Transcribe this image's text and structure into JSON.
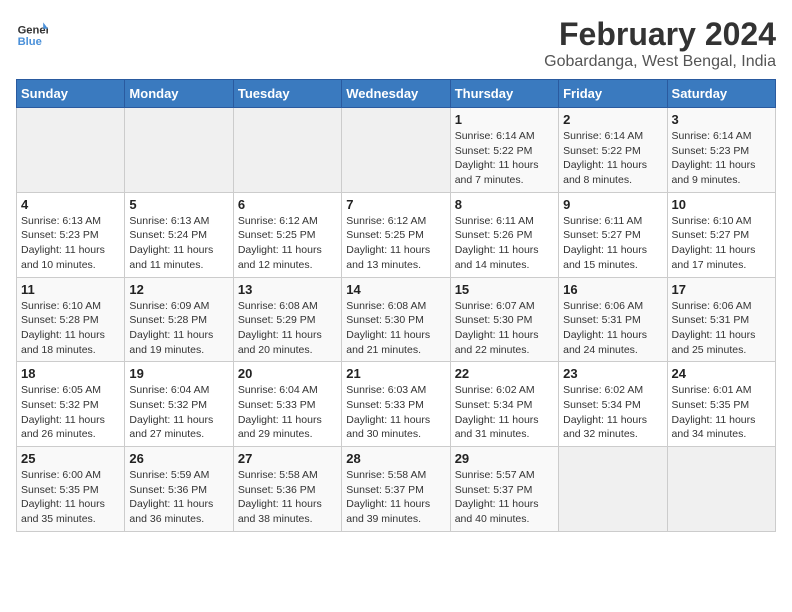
{
  "header": {
    "logo_line1": "General",
    "logo_line2": "Blue",
    "month_year": "February 2024",
    "location": "Gobardanga, West Bengal, India"
  },
  "days_of_week": [
    "Sunday",
    "Monday",
    "Tuesday",
    "Wednesday",
    "Thursday",
    "Friday",
    "Saturday"
  ],
  "weeks": [
    [
      {
        "day": "",
        "info": ""
      },
      {
        "day": "",
        "info": ""
      },
      {
        "day": "",
        "info": ""
      },
      {
        "day": "",
        "info": ""
      },
      {
        "day": "1",
        "info": "Sunrise: 6:14 AM\nSunset: 5:22 PM\nDaylight: 11 hours\nand 7 minutes."
      },
      {
        "day": "2",
        "info": "Sunrise: 6:14 AM\nSunset: 5:22 PM\nDaylight: 11 hours\nand 8 minutes."
      },
      {
        "day": "3",
        "info": "Sunrise: 6:14 AM\nSunset: 5:23 PM\nDaylight: 11 hours\nand 9 minutes."
      }
    ],
    [
      {
        "day": "4",
        "info": "Sunrise: 6:13 AM\nSunset: 5:23 PM\nDaylight: 11 hours\nand 10 minutes."
      },
      {
        "day": "5",
        "info": "Sunrise: 6:13 AM\nSunset: 5:24 PM\nDaylight: 11 hours\nand 11 minutes."
      },
      {
        "day": "6",
        "info": "Sunrise: 6:12 AM\nSunset: 5:25 PM\nDaylight: 11 hours\nand 12 minutes."
      },
      {
        "day": "7",
        "info": "Sunrise: 6:12 AM\nSunset: 5:25 PM\nDaylight: 11 hours\nand 13 minutes."
      },
      {
        "day": "8",
        "info": "Sunrise: 6:11 AM\nSunset: 5:26 PM\nDaylight: 11 hours\nand 14 minutes."
      },
      {
        "day": "9",
        "info": "Sunrise: 6:11 AM\nSunset: 5:27 PM\nDaylight: 11 hours\nand 15 minutes."
      },
      {
        "day": "10",
        "info": "Sunrise: 6:10 AM\nSunset: 5:27 PM\nDaylight: 11 hours\nand 17 minutes."
      }
    ],
    [
      {
        "day": "11",
        "info": "Sunrise: 6:10 AM\nSunset: 5:28 PM\nDaylight: 11 hours\nand 18 minutes."
      },
      {
        "day": "12",
        "info": "Sunrise: 6:09 AM\nSunset: 5:28 PM\nDaylight: 11 hours\nand 19 minutes."
      },
      {
        "day": "13",
        "info": "Sunrise: 6:08 AM\nSunset: 5:29 PM\nDaylight: 11 hours\nand 20 minutes."
      },
      {
        "day": "14",
        "info": "Sunrise: 6:08 AM\nSunset: 5:30 PM\nDaylight: 11 hours\nand 21 minutes."
      },
      {
        "day": "15",
        "info": "Sunrise: 6:07 AM\nSunset: 5:30 PM\nDaylight: 11 hours\nand 22 minutes."
      },
      {
        "day": "16",
        "info": "Sunrise: 6:06 AM\nSunset: 5:31 PM\nDaylight: 11 hours\nand 24 minutes."
      },
      {
        "day": "17",
        "info": "Sunrise: 6:06 AM\nSunset: 5:31 PM\nDaylight: 11 hours\nand 25 minutes."
      }
    ],
    [
      {
        "day": "18",
        "info": "Sunrise: 6:05 AM\nSunset: 5:32 PM\nDaylight: 11 hours\nand 26 minutes."
      },
      {
        "day": "19",
        "info": "Sunrise: 6:04 AM\nSunset: 5:32 PM\nDaylight: 11 hours\nand 27 minutes."
      },
      {
        "day": "20",
        "info": "Sunrise: 6:04 AM\nSunset: 5:33 PM\nDaylight: 11 hours\nand 29 minutes."
      },
      {
        "day": "21",
        "info": "Sunrise: 6:03 AM\nSunset: 5:33 PM\nDaylight: 11 hours\nand 30 minutes."
      },
      {
        "day": "22",
        "info": "Sunrise: 6:02 AM\nSunset: 5:34 PM\nDaylight: 11 hours\nand 31 minutes."
      },
      {
        "day": "23",
        "info": "Sunrise: 6:02 AM\nSunset: 5:34 PM\nDaylight: 11 hours\nand 32 minutes."
      },
      {
        "day": "24",
        "info": "Sunrise: 6:01 AM\nSunset: 5:35 PM\nDaylight: 11 hours\nand 34 minutes."
      }
    ],
    [
      {
        "day": "25",
        "info": "Sunrise: 6:00 AM\nSunset: 5:35 PM\nDaylight: 11 hours\nand 35 minutes."
      },
      {
        "day": "26",
        "info": "Sunrise: 5:59 AM\nSunset: 5:36 PM\nDaylight: 11 hours\nand 36 minutes."
      },
      {
        "day": "27",
        "info": "Sunrise: 5:58 AM\nSunset: 5:36 PM\nDaylight: 11 hours\nand 38 minutes."
      },
      {
        "day": "28",
        "info": "Sunrise: 5:58 AM\nSunset: 5:37 PM\nDaylight: 11 hours\nand 39 minutes."
      },
      {
        "day": "29",
        "info": "Sunrise: 5:57 AM\nSunset: 5:37 PM\nDaylight: 11 hours\nand 40 minutes."
      },
      {
        "day": "",
        "info": ""
      },
      {
        "day": "",
        "info": ""
      }
    ]
  ]
}
